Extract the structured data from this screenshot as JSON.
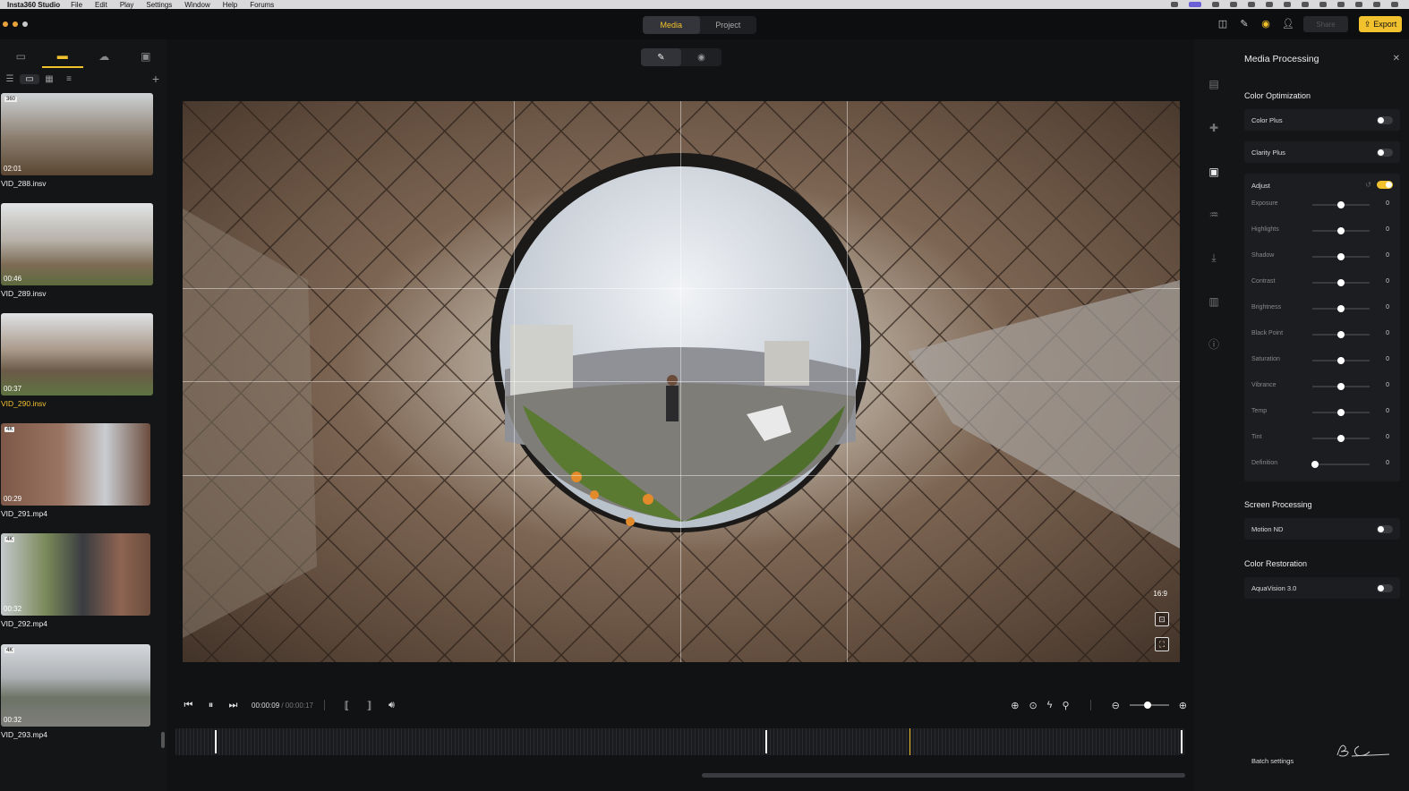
{
  "menubar": {
    "app_name": "Insta360 Studio",
    "items": [
      "File",
      "Edit",
      "Play",
      "Settings",
      "Window",
      "Help",
      "Forums"
    ]
  },
  "titlebar": {
    "tabs": [
      {
        "label": "Media",
        "active": true
      },
      {
        "label": "Project",
        "active": false
      }
    ],
    "share_label": "Share",
    "export_label": "Export"
  },
  "sidebar": {
    "clips": [
      {
        "name": "VID_288.insv",
        "duration": "02:01",
        "selected": false
      },
      {
        "name": "VID_289.insv",
        "duration": "00:46",
        "selected": false
      },
      {
        "name": "VID_290.insv",
        "duration": "00:37",
        "selected": true
      },
      {
        "name": "VID_291.mp4",
        "duration": "00:29",
        "badge": "4K",
        "selected": false
      },
      {
        "name": "VID_292.mp4",
        "duration": "00:32",
        "badge": "4K",
        "selected": false
      },
      {
        "name": "VID_293.mp4",
        "duration": "00:32",
        "badge": "4K",
        "selected": false
      }
    ]
  },
  "viewer": {
    "aspect_ratio": "16:9"
  },
  "transport": {
    "current_time": "00:00:09",
    "total_time": " / 00:00:17"
  },
  "panel": {
    "title": "Media Processing",
    "color_optimization": {
      "heading": "Color Optimization",
      "color_plus": {
        "label": "Color Plus",
        "on": false
      },
      "clarity_plus": {
        "label": "Clarity Plus",
        "on": false
      }
    },
    "adjust": {
      "label": "Adjust",
      "on": true,
      "sliders": [
        {
          "label": "Exposure",
          "value": "0",
          "pos": 0.5
        },
        {
          "label": "Highlights",
          "value": "0",
          "pos": 0.5
        },
        {
          "label": "Shadow",
          "value": "0",
          "pos": 0.5
        },
        {
          "label": "Contrast",
          "value": "0",
          "pos": 0.5
        },
        {
          "label": "Brightness",
          "value": "0",
          "pos": 0.5
        },
        {
          "label": "Black Point",
          "value": "0",
          "pos": 0.5
        },
        {
          "label": "Saturation",
          "value": "0",
          "pos": 0.5
        },
        {
          "label": "Vibrance",
          "value": "0",
          "pos": 0.5
        },
        {
          "label": "Temp",
          "value": "0",
          "pos": 0.5
        },
        {
          "label": "Tint",
          "value": "0",
          "pos": 0.5
        },
        {
          "label": "Definition",
          "value": "0",
          "pos": 0.05
        }
      ]
    },
    "screen_processing": {
      "heading": "Screen Processing",
      "motion_nd": {
        "label": "Motion ND",
        "on": false
      }
    },
    "color_restoration": {
      "heading": "Color Restoration",
      "aquavision": {
        "label": "AquaVision 3.0",
        "on": false
      }
    },
    "batch_label": "Batch settings"
  },
  "colors": {
    "accent": "#f2c12e",
    "background": "#111214"
  }
}
